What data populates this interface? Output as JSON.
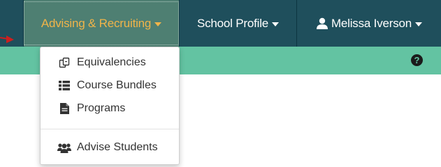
{
  "nav": {
    "items": [
      {
        "label": "Advising & Recruiting",
        "active": true
      },
      {
        "label": "School Profile",
        "active": false
      },
      {
        "label": "Melissa Iverson",
        "active": false
      }
    ],
    "help_icon": "question-circle-icon"
  },
  "dropdown": {
    "items": [
      {
        "label": "Equivalencies",
        "icon": "equivalencies-icon"
      },
      {
        "label": "Course Bundles",
        "icon": "list-icon"
      },
      {
        "label": "Programs",
        "icon": "document-icon"
      },
      {
        "label": "Advise Students",
        "icon": "users-icon"
      }
    ]
  },
  "colors": {
    "navbar": "#1f4f5c",
    "active_tab": "#4e7f72",
    "active_text": "#f0b44a",
    "subbar": "#63c3a2",
    "arrow": "#cc1f1f"
  }
}
